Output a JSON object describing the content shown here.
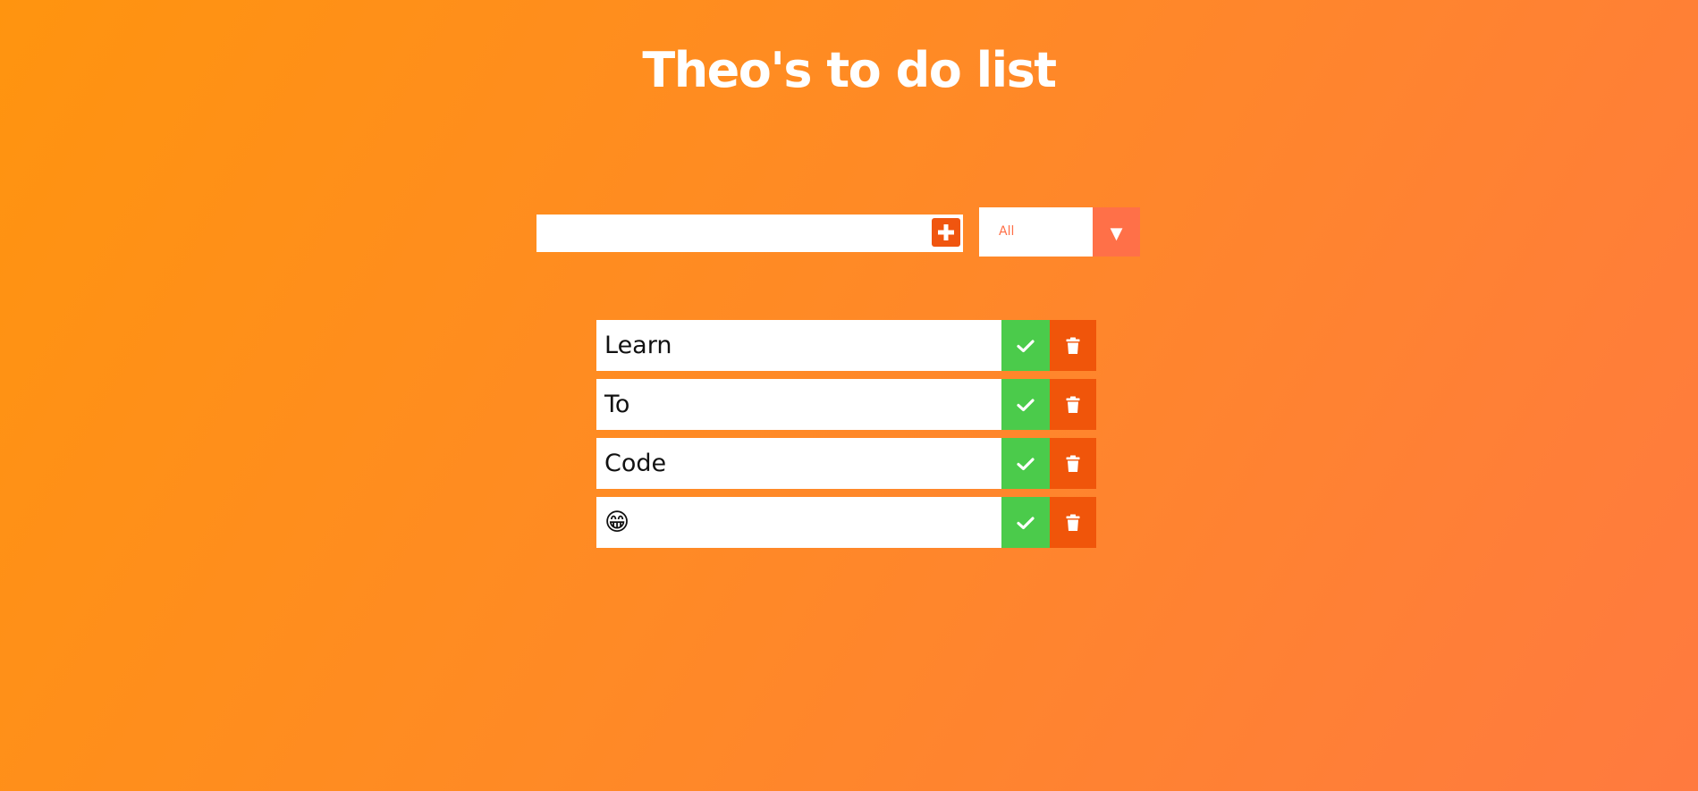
{
  "header": {
    "title": "Theo's to do list"
  },
  "form": {
    "input_value": "",
    "input_placeholder": "",
    "add_icon": "plus-square-icon",
    "filter_selected": "All",
    "filter_arrow_icon": "dropdown-triangle-icon"
  },
  "todos": [
    {
      "text": "Learn"
    },
    {
      "text": "To"
    },
    {
      "text": "Code"
    },
    {
      "text": "😁"
    }
  ],
  "colors": {
    "background_start": "#ff940f",
    "background_end": "#ff7a3f",
    "complete_button": "#4bcb4b",
    "trash_button": "#f0550a",
    "add_button": "#f0550f",
    "filter_text": "#ff6f47",
    "filter_arrow_bg": "#ff7048"
  },
  "icons": {
    "complete": "check-icon",
    "trash": "trash-icon"
  }
}
